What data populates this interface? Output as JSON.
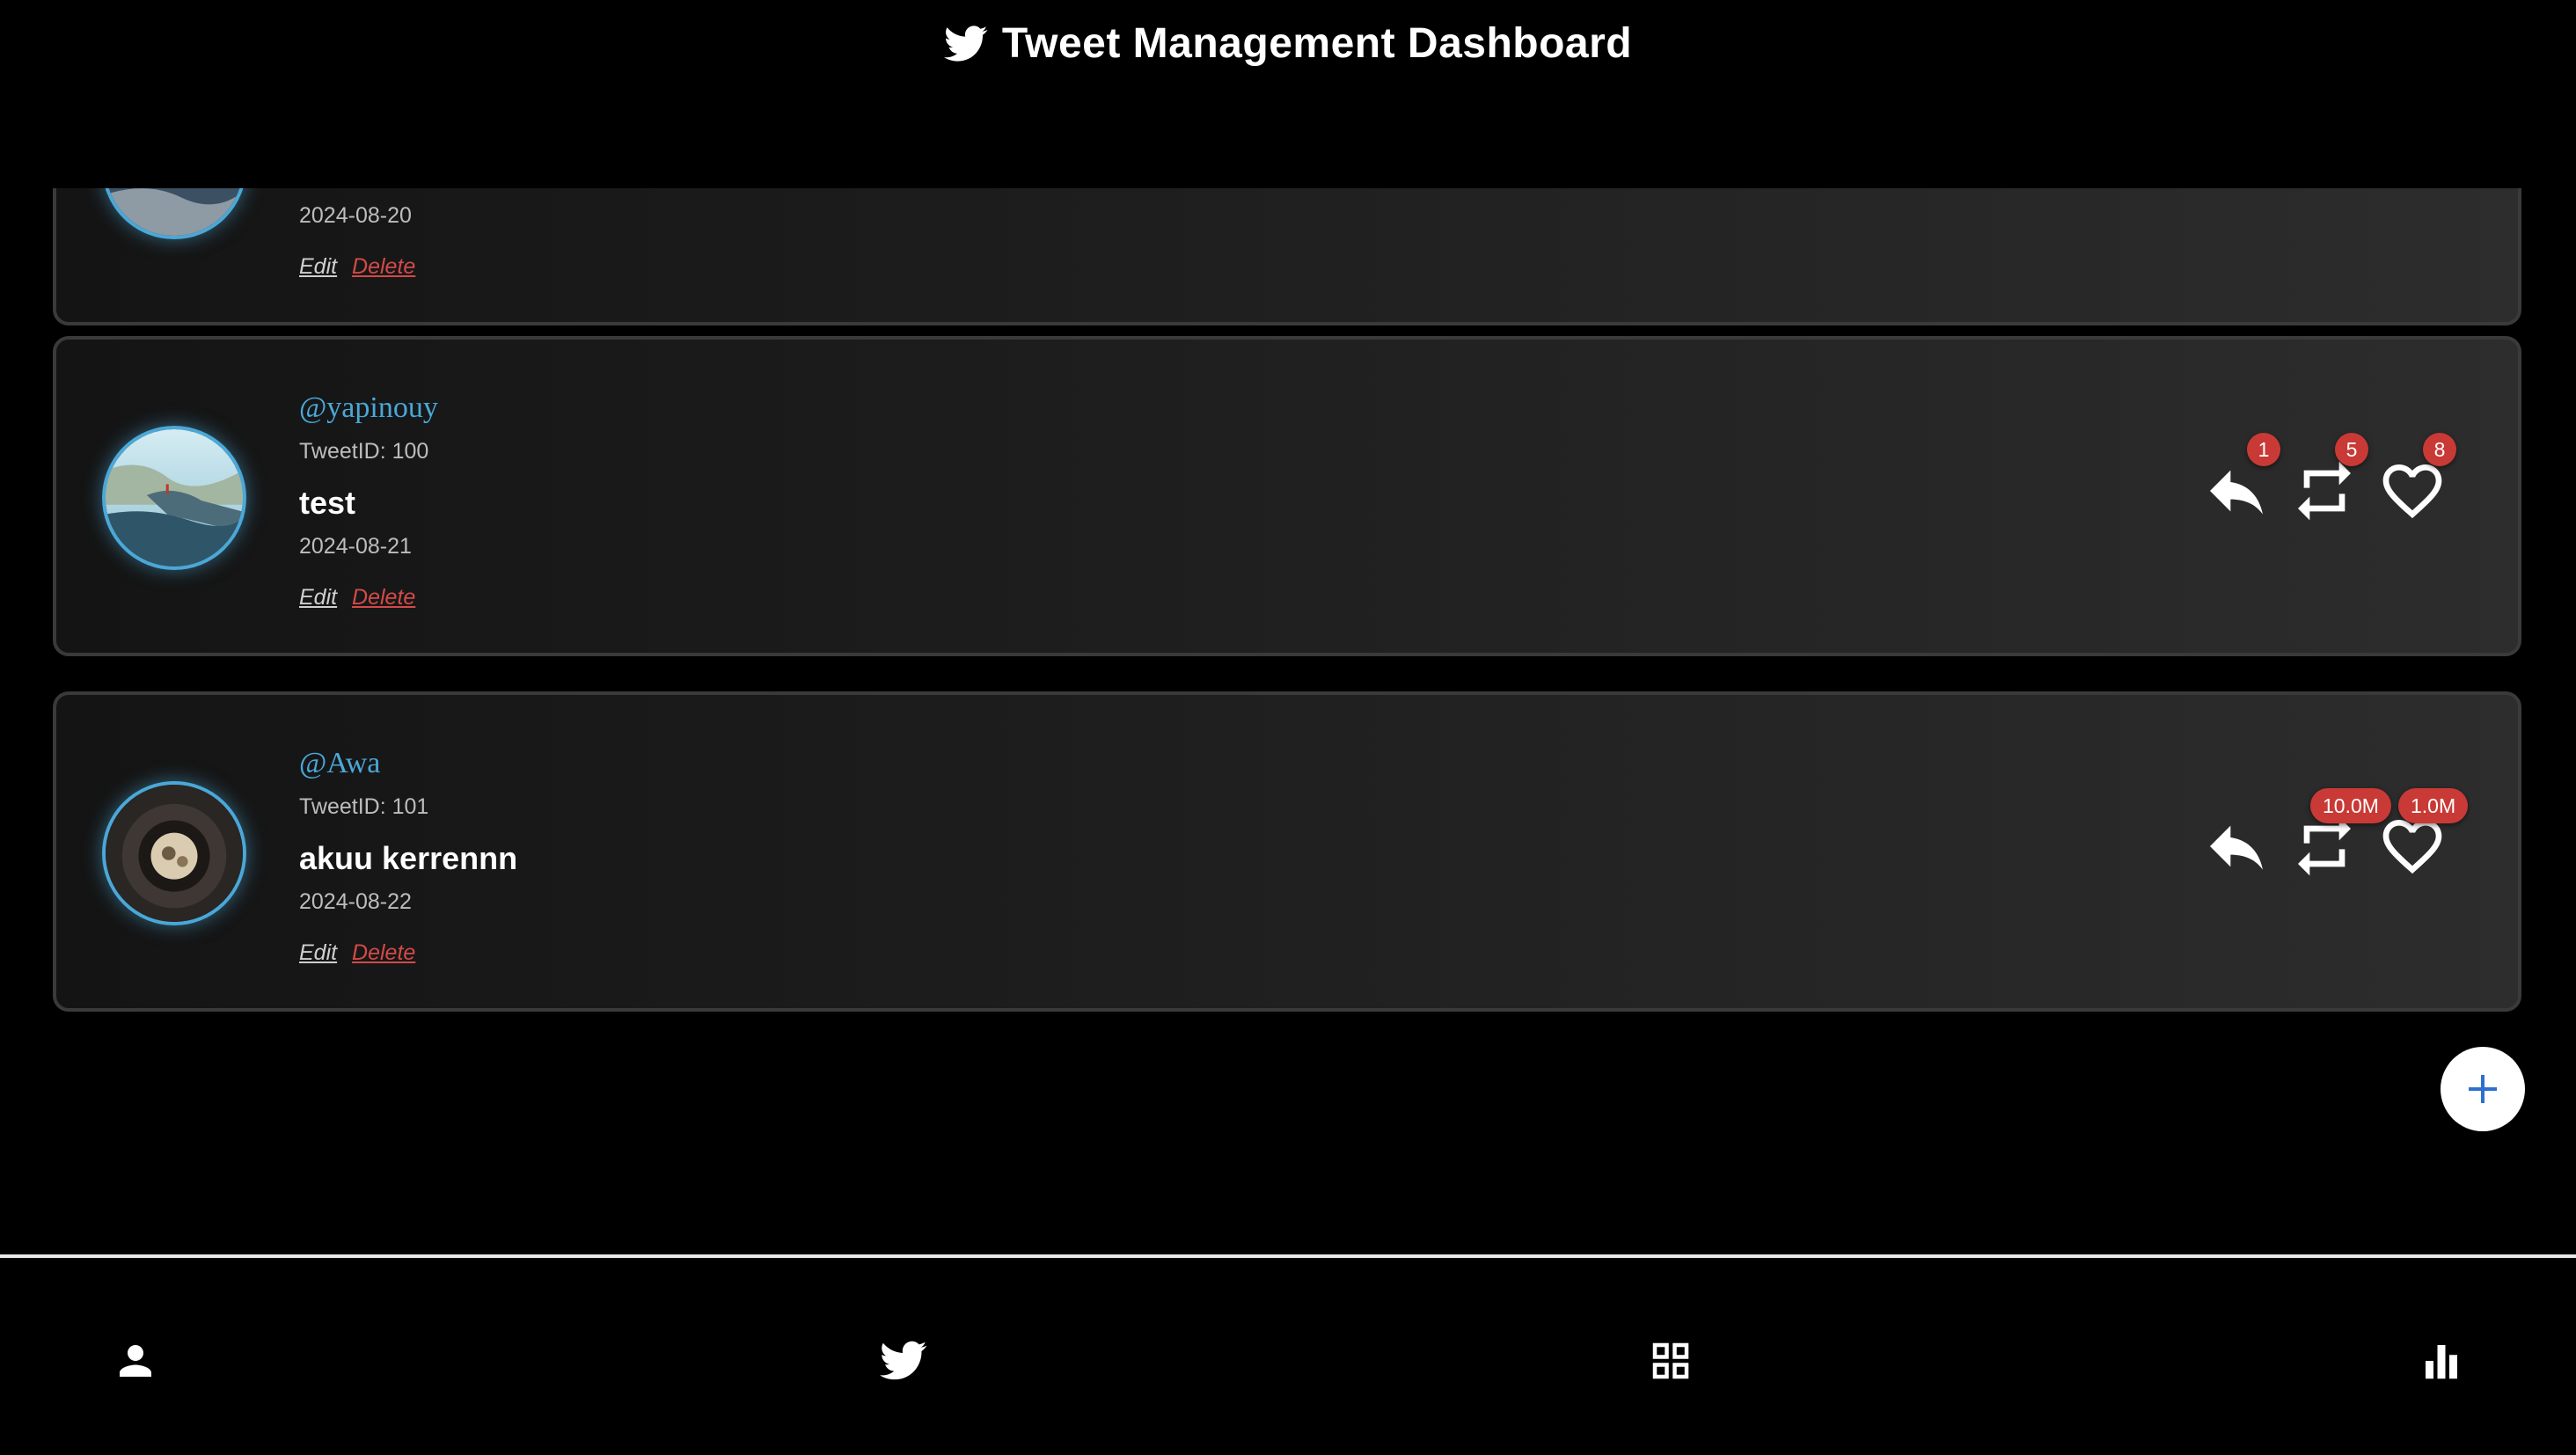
{
  "header": {
    "title": "Tweet Management Dashboard",
    "logo_icon": "twitter-bird-icon"
  },
  "colors": {
    "background": "#000000",
    "username": "#4aa8d8",
    "badge": "#c93a36",
    "delete_link": "#d24a48",
    "fab_plus": "#2f6fd0"
  },
  "tweets": [
    {
      "username": "",
      "tweet_id": "",
      "content": "",
      "date": "2024-08-20",
      "edit_label": "Edit",
      "delete_label": "Delete"
    },
    {
      "username": "@yapinouy",
      "tweet_id": "TweetID: 100",
      "content": "test",
      "date": "2024-08-21",
      "edit_label": "Edit",
      "delete_label": "Delete",
      "replies": "1",
      "retweets": "5",
      "likes": "8"
    },
    {
      "username": "@Awa",
      "tweet_id": "TweetID: 101",
      "content": "akuu kerrennn",
      "date": "2024-08-22",
      "edit_label": "Edit",
      "delete_label": "Delete",
      "retweets": "10.0M",
      "likes": "1.0M"
    }
  ],
  "fab": {
    "icon": "plus-icon"
  },
  "bottom_nav": {
    "items": [
      {
        "icon": "person-icon"
      },
      {
        "icon": "twitter-bird-icon"
      },
      {
        "icon": "grid-icon"
      },
      {
        "icon": "bar-chart-icon"
      }
    ]
  }
}
